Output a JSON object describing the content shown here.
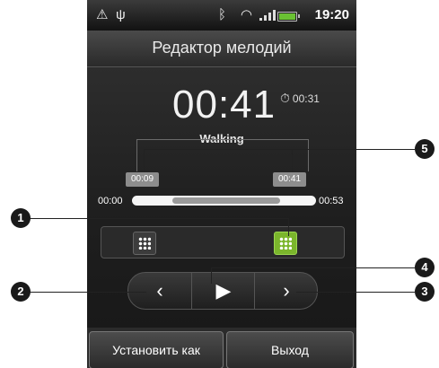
{
  "status_bar": {
    "time": "19:20",
    "icons": [
      "warning-icon",
      "usb-icon",
      "bluetooth-icon",
      "wifi-icon",
      "signal-icon",
      "battery-icon"
    ]
  },
  "header": {
    "title": "Редактор мелодий"
  },
  "player": {
    "current_time": "00:41",
    "total_time": "00:31",
    "song": "Walking",
    "start_marker": "00:09",
    "end_marker": "00:41",
    "timeline_start": "00:00",
    "timeline_end": "00:53"
  },
  "controls": {
    "prev": "‹",
    "play": "▶",
    "next": "›"
  },
  "bottom": {
    "set_as": "Установить как",
    "exit": "Выход"
  },
  "callouts": {
    "c1": "1",
    "c2": "2",
    "c3": "3",
    "c4": "4",
    "c5": "5"
  },
  "colors": {
    "accent_handle": "#7bb62c",
    "battery": "#6ac133"
  }
}
